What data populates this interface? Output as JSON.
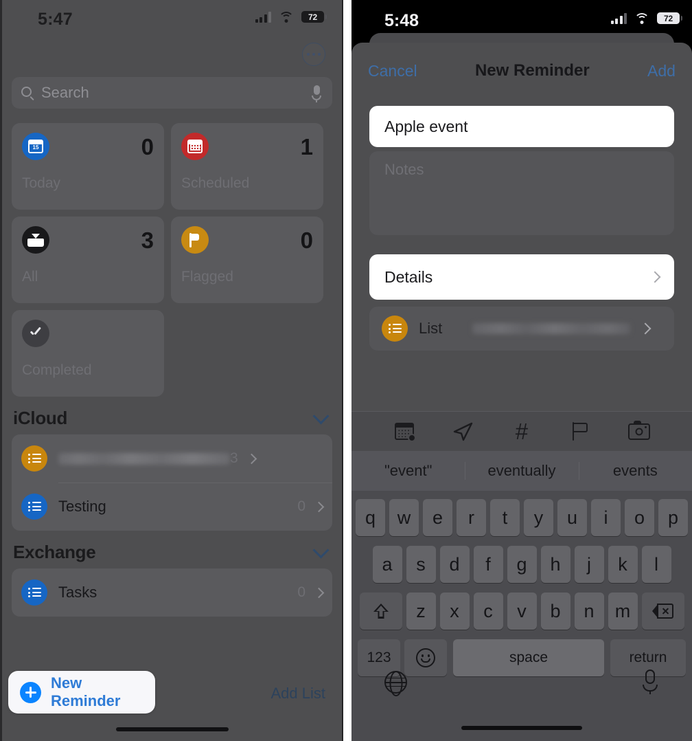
{
  "left_phone": {
    "status_bar": {
      "time": "5:47",
      "battery": "72",
      "signal_icon": "cellular-bars-icon",
      "wifi_icon": "wifi-icon",
      "battery_icon": "battery-icon"
    },
    "more_button": {
      "icon": "ellipsis-circle-icon"
    },
    "search": {
      "placeholder": "Search",
      "icon": "search-icon",
      "mic_icon": "microphone-icon"
    },
    "smart_cards": [
      {
        "label": "Today",
        "count": "0",
        "icon": "calendar-today-icon",
        "color": "#1666c4"
      },
      {
        "label": "Scheduled",
        "count": "1",
        "icon": "calendar-scheduled-icon",
        "color": "#c22a2a"
      },
      {
        "label": "All",
        "count": "3",
        "icon": "inbox-tray-icon",
        "color": "#18181a"
      },
      {
        "label": "Flagged",
        "count": "0",
        "icon": "flag-icon",
        "color": "#c88a12"
      },
      {
        "label": "Completed",
        "count": "",
        "icon": "checkmark-circle-icon",
        "color": "#3e3e42"
      }
    ],
    "sections": [
      {
        "title": "iCloud",
        "chevron_icon": "chevron-down-icon",
        "rows": [
          {
            "name": "",
            "blurred": true,
            "count": "3",
            "icon": "list-bullets-icon",
            "color": "#c8860d",
            "chevron_icon": "chevron-right-icon"
          },
          {
            "name": "Testing",
            "blurred": false,
            "count": "0",
            "icon": "list-bullets-icon",
            "color": "#1666c4",
            "chevron_icon": "chevron-right-icon"
          }
        ]
      },
      {
        "title": "Exchange",
        "chevron_icon": "chevron-down-icon",
        "rows": [
          {
            "name": "Tasks",
            "blurred": false,
            "count": "0",
            "icon": "list-bullets-icon",
            "color": "#1666c4",
            "chevron_icon": "chevron-right-icon"
          }
        ]
      }
    ],
    "footer": {
      "new_reminder_label": "New Reminder",
      "new_reminder_icon": "plus-circle-icon",
      "add_list_label": "Add List"
    }
  },
  "right_phone": {
    "status_bar": {
      "time": "5:48",
      "battery": "72",
      "signal_icon": "cellular-bars-icon",
      "wifi_icon": "wifi-icon",
      "battery_icon": "battery-icon"
    },
    "sheet": {
      "cancel_label": "Cancel",
      "title": "New Reminder",
      "add_label": "Add",
      "title_field_value": "Apple event",
      "notes_placeholder": "Notes",
      "details_label": "Details",
      "details_chevron_icon": "chevron-right-icon",
      "list_label": "List",
      "list_value_blurred": true,
      "list_icon": "list-bullets-icon",
      "list_icon_color": "#c8860d",
      "list_chevron_icon": "chevron-right-icon"
    },
    "keyboard_toolbar": [
      {
        "icon": "calendar-clock-icon"
      },
      {
        "icon": "location-arrow-icon"
      },
      {
        "icon": "hashtag-icon"
      },
      {
        "icon": "flag-outline-icon"
      },
      {
        "icon": "camera-icon"
      }
    ],
    "suggestions": [
      "\"event\"",
      "eventually",
      "events"
    ],
    "keyboard": {
      "row1": [
        "q",
        "w",
        "e",
        "r",
        "t",
        "y",
        "u",
        "i",
        "o",
        "p"
      ],
      "row2": [
        "a",
        "s",
        "d",
        "f",
        "g",
        "h",
        "j",
        "k",
        "l"
      ],
      "row3": [
        "z",
        "x",
        "c",
        "v",
        "b",
        "n",
        "m"
      ],
      "shift_icon": "shift-icon",
      "delete_icon": "delete-backward-icon",
      "numbers_label": "123",
      "emoji_icon": "emoji-smiley-icon",
      "space_label": "space",
      "return_label": "return",
      "globe_icon": "globe-icon",
      "dictation_icon": "microphone-icon"
    }
  },
  "colors": {
    "accent_blue": "#0a84ff",
    "link_blue": "#3e6ea8",
    "orange": "#c8860d",
    "red": "#c22a2a"
  }
}
